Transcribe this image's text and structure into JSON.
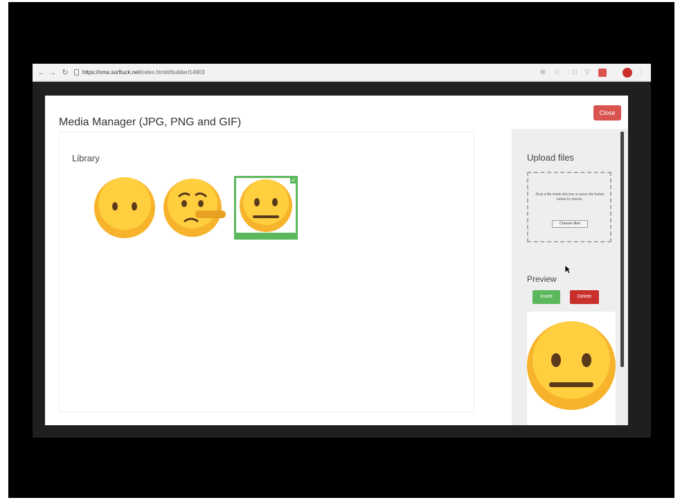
{
  "browser": {
    "url_host": "https://oms.surftuck.net",
    "url_path": "/index.html#/builder/14903"
  },
  "modal": {
    "title": "Media Manager (JPG, PNG and GIF)",
    "close_label": "Close"
  },
  "library": {
    "title": "Library",
    "items": [
      {
        "name": "face-without-mouth",
        "selected": false
      },
      {
        "name": "lying-face",
        "selected": false
      },
      {
        "name": "neutral-face",
        "selected": true
      }
    ]
  },
  "upload": {
    "title": "Upload files",
    "dropzone_text": "Drop a file inside this box or press the button below to choose.",
    "choose_label": "Choose files"
  },
  "preview": {
    "title": "Preview",
    "insert_label": "Insert",
    "delete_label": "Delete"
  },
  "colors": {
    "success": "#5cb85c",
    "danger": "#d9534f",
    "face_fill": "#f7b32b",
    "face_highlight": "#ffd74a"
  }
}
